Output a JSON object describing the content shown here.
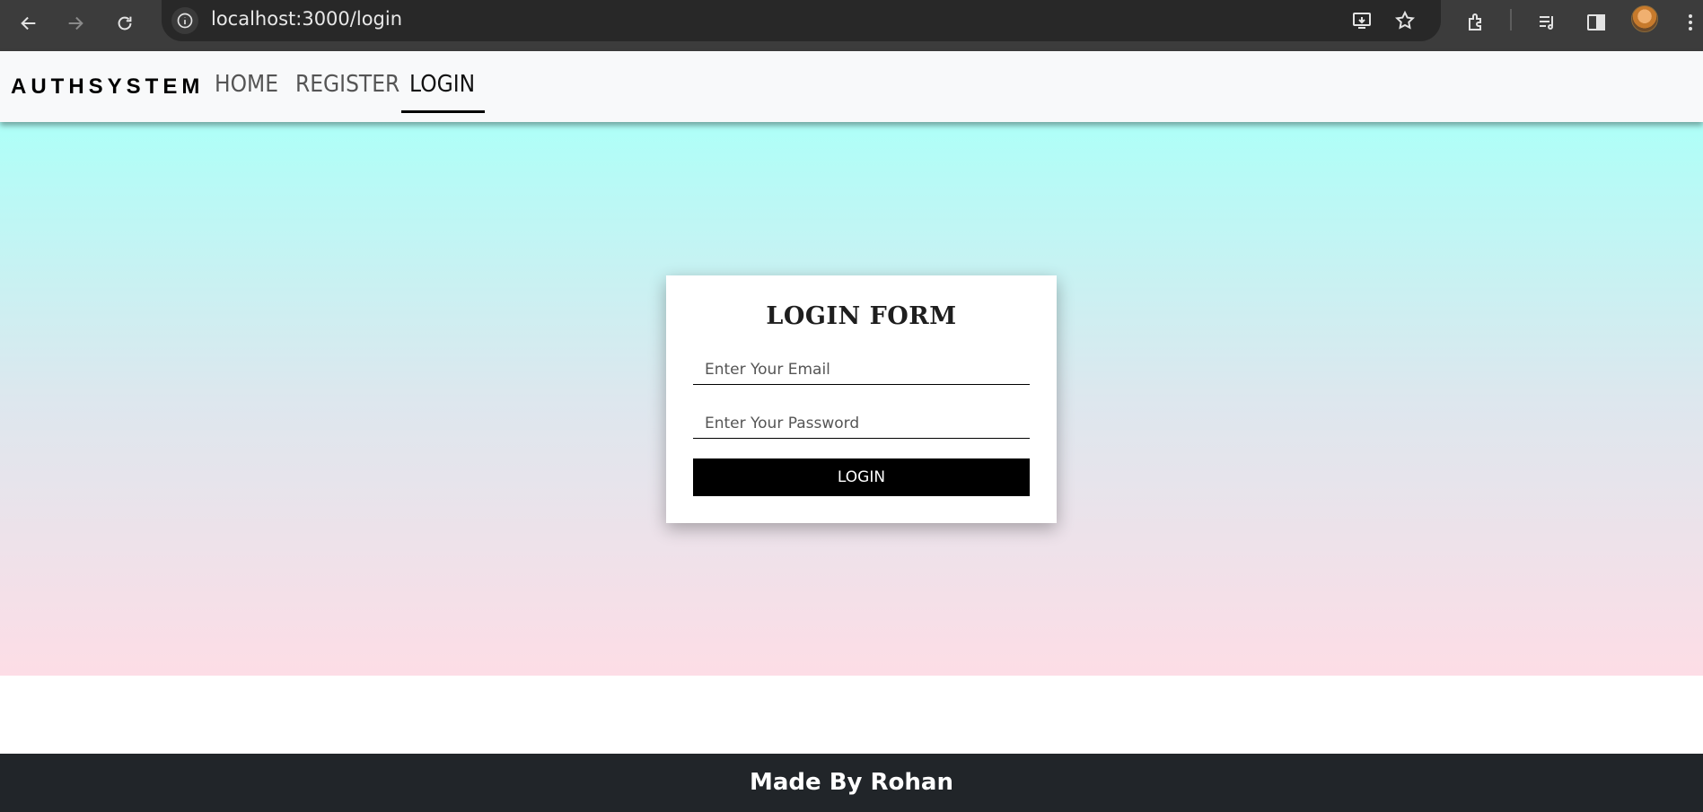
{
  "browser": {
    "url": "localhost:3000/login"
  },
  "navbar": {
    "brand": "AUTHSYSTEM",
    "links": [
      {
        "label": "HOME",
        "active": false
      },
      {
        "label": "REGISTER",
        "active": false
      },
      {
        "label": "LOGIN",
        "active": true
      }
    ]
  },
  "login_form": {
    "title": "LOGIN FORM",
    "email_placeholder": "Enter Your Email",
    "email_value": "",
    "password_placeholder": "Enter Your Password",
    "password_value": "",
    "submit_label": "LOGIN"
  },
  "footer": {
    "text": "Made By Rohan"
  },
  "colors": {
    "gradient_top": "#aefff8",
    "gradient_bottom": "#fddde6",
    "footer_bg": "#212529",
    "button_bg": "#000000"
  }
}
